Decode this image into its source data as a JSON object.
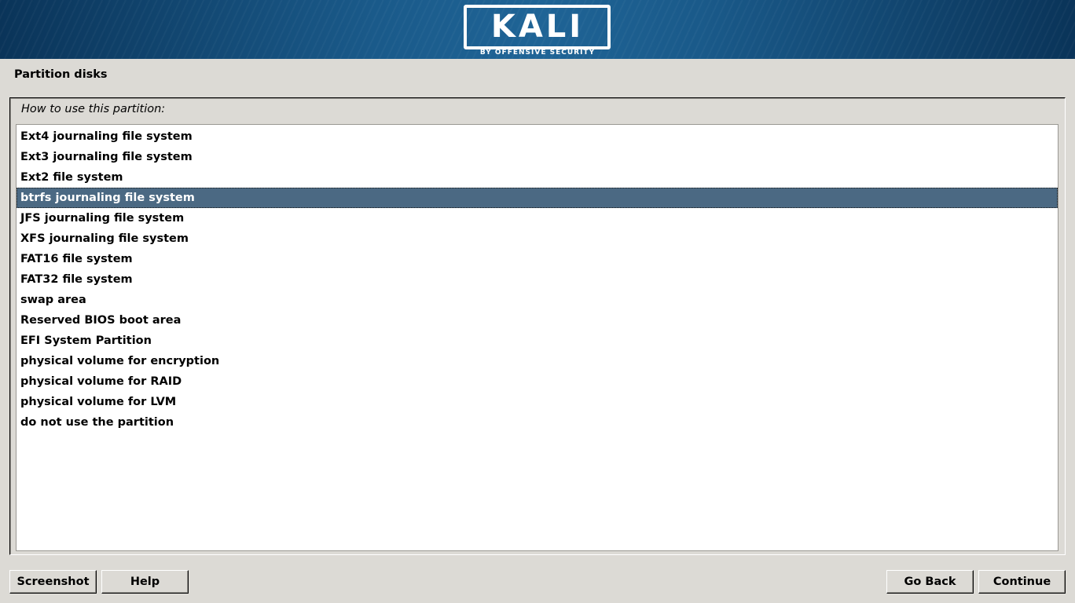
{
  "banner": {
    "logo_text": "KALI",
    "logo_subtitle": "BY OFFENSIVE SECURITY"
  },
  "page": {
    "title": "Partition disks",
    "question": "How to use this partition:"
  },
  "options": [
    {
      "label": "Ext4 journaling file system",
      "selected": false
    },
    {
      "label": "Ext3 journaling file system",
      "selected": false
    },
    {
      "label": "Ext2 file system",
      "selected": false
    },
    {
      "label": "btrfs journaling file system",
      "selected": true
    },
    {
      "label": "JFS journaling file system",
      "selected": false
    },
    {
      "label": "XFS journaling file system",
      "selected": false
    },
    {
      "label": "FAT16 file system",
      "selected": false
    },
    {
      "label": "FAT32 file system",
      "selected": false
    },
    {
      "label": "swap area",
      "selected": false
    },
    {
      "label": "Reserved BIOS boot area",
      "selected": false
    },
    {
      "label": "EFI System Partition",
      "selected": false
    },
    {
      "label": "physical volume for encryption",
      "selected": false
    },
    {
      "label": "physical volume for RAID",
      "selected": false
    },
    {
      "label": "physical volume for LVM",
      "selected": false
    },
    {
      "label": "do not use the partition",
      "selected": false
    }
  ],
  "buttons": {
    "screenshot": "Screenshot",
    "help": "Help",
    "go_back": "Go Back",
    "continue": "Continue"
  },
  "colors": {
    "banner": "#1a5a8a",
    "background": "#dcdad5",
    "selection": "#4b6983"
  }
}
